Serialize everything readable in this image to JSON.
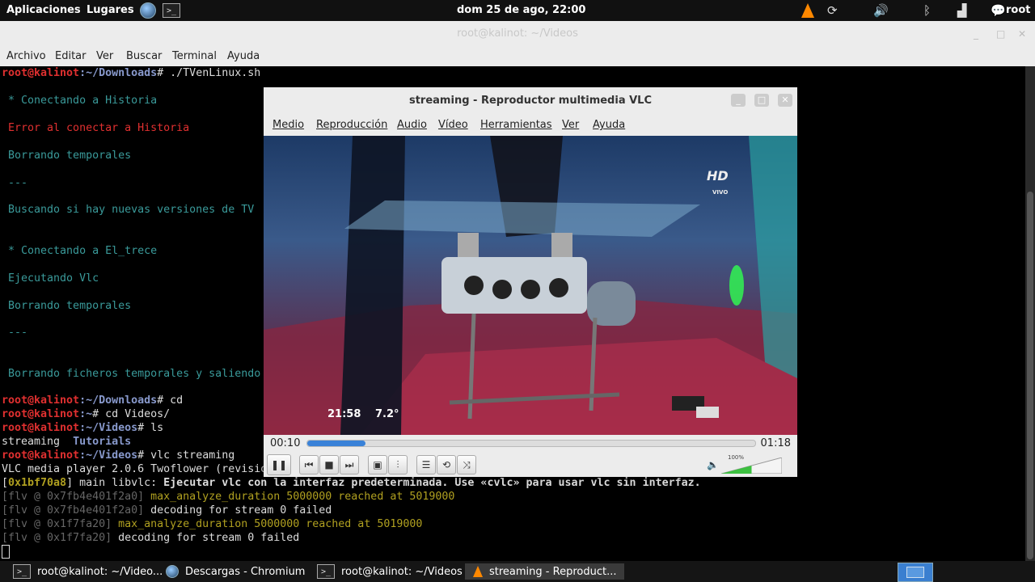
{
  "topbar": {
    "apps_label": "Aplicaciones",
    "places_label": "Lugares",
    "clock": "dom 25 de ago, 22:00",
    "user": "root",
    "icons": [
      "globe-icon",
      "terminal-icon",
      "vlc-cone-icon",
      "update-icon",
      "volume-icon",
      "bluetooth-icon",
      "signal-icon",
      "chat-icon"
    ]
  },
  "terminal": {
    "title": "root@kalinot: ~/Videos",
    "menu": [
      "Archivo",
      "Editar",
      "Ver",
      "Buscar",
      "Terminal",
      "Ayuda"
    ],
    "prompt_user": "root@kalinot",
    "lines": {
      "l1_path": ":~/Downloads",
      "l1_cmd": "# ./TVenLinux.sh",
      "l2": " * Conectando a Historia",
      "l3": " Error al conectar a Historia",
      "l4": " Borrando temporales",
      "l5": " ---",
      "l6": " Buscando si hay nuevas versiones de TV",
      "l7": " * Conectando a El_trece",
      "l8": " Ejecutando Vlc",
      "l9": " Borrando temporales",
      "l10": " ---",
      "l11": " Borrando ficheros temporales y saliendo",
      "l12_path": ":~/Downloads",
      "l12_cmd": "# cd",
      "l13_path": ":~",
      "l13_cmd": "# cd Videos/",
      "l14_path": ":~/Videos",
      "l14_cmd": "# ls",
      "l15_a": "streaming",
      "l15_b": "Tutorials",
      "l16_path": ":~/Videos",
      "l16_cmd": "# vlc streaming",
      "l17": "VLC media player 2.0.6 Twoflower (revision",
      "l18_addr": "0x1bf70a8",
      "l18_a": "] main libvlc: ",
      "l18_b": "Ejecutar vlc con la interfaz predeterminada. Use «cvlc» para usar vlc sin interfaz.",
      "l19_a": "[flv @ 0x7fb4e401f2a0] ",
      "l19_b": "max_analyze_duration 5000000 reached at 5019000",
      "l20_a": "[flv @ 0x7fb4e401f2a0] ",
      "l20_b": "decoding for stream 0 failed",
      "l21_a": "[flv @ 0x1f7fa20] ",
      "l21_b": "max_analyze_duration 5000000 reached at 5019000",
      "l22_a": "[flv @ 0x1f7fa20] ",
      "l22_b": "decoding for stream 0 failed"
    }
  },
  "vlc": {
    "title": "streaming - Reproductor multimedia VLC",
    "menu": [
      "Medio",
      "Reproducción",
      "Audio",
      "Vídeo",
      "Herramientas",
      "Ver",
      "Ayuda"
    ],
    "overlay_time": "21:58",
    "overlay_temp": "7.2°",
    "channel_logo": "HD",
    "channel_live": "VIVO",
    "elapsed": "00:10",
    "duration": "01:18",
    "progress": 0.13,
    "volume_pct": "100%",
    "volume_level": 1.0
  },
  "taskbar": {
    "tasks": [
      "root@kalinot: ~/Video...",
      "Descargas - Chromium",
      "root@kalinot: ~/Videos",
      "streaming - Reproduct..."
    ]
  }
}
